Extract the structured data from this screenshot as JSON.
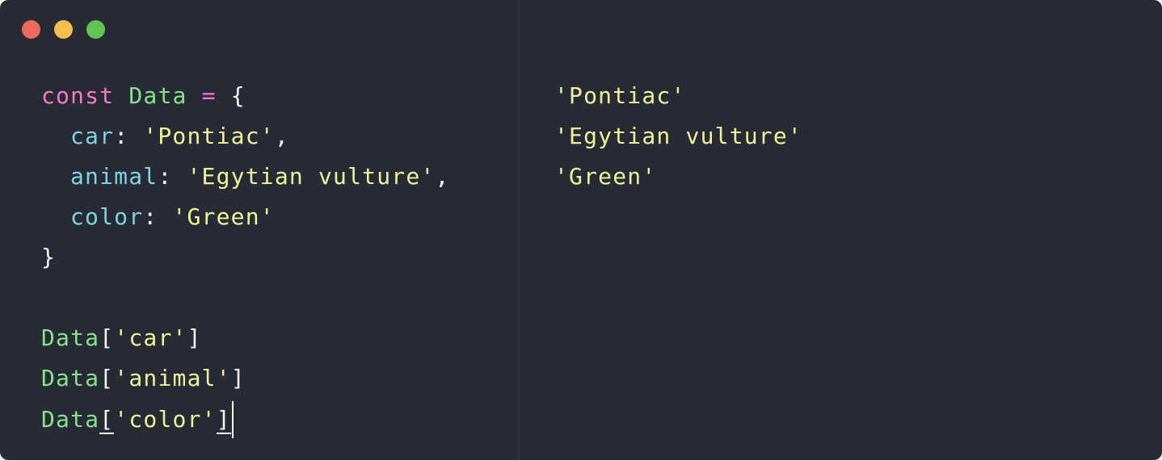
{
  "window": {
    "controls": [
      "close",
      "minimize",
      "maximize"
    ]
  },
  "editor": {
    "line1": {
      "kw": "const",
      "name": "Data",
      "op": "=",
      "brace": "{"
    },
    "line2": {
      "key": "car",
      "colon": ":",
      "value": "'Pontiac'",
      "comma": ","
    },
    "line3": {
      "key": "animal",
      "colon": ":",
      "value": "'Egytian vulture'",
      "comma": ","
    },
    "line4": {
      "key": "color",
      "colon": ":",
      "value": "'Green'"
    },
    "line5": {
      "brace": "}"
    },
    "line7": {
      "obj": "Data",
      "open": "[",
      "arg": "'car'",
      "close": "]"
    },
    "line8": {
      "obj": "Data",
      "open": "[",
      "arg": "'animal'",
      "close": "]"
    },
    "line9": {
      "obj": "Data",
      "open": "[",
      "arg": "'color'",
      "close": "]"
    }
  },
  "output": {
    "results": [
      "'Pontiac'",
      "'Egytian vulture'",
      "'Green'"
    ]
  },
  "colors": {
    "background": "#282a36",
    "keyword": "#ff79c6",
    "identifier": "#86e38b",
    "property": "#7fd3e6",
    "string": "#eef39a",
    "text": "#f8f8f2"
  }
}
